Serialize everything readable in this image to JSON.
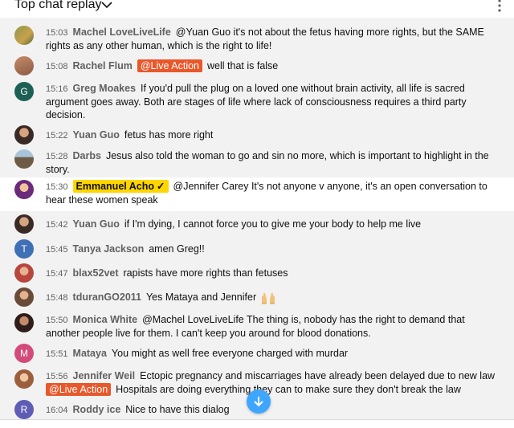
{
  "header": {
    "title": "Top chat replay",
    "chevron_icon": "chevron-down-icon",
    "menu_icon": "more-vert-icon"
  },
  "messages": [
    {
      "time": "15:03",
      "author": "Machel LoveLiveLife",
      "text": "@Yuan Guo it's not about the fetus having more rights, but the SAME rights as any other human, which is the right to life!"
    },
    {
      "time": "15:08",
      "author": "Rachel Flum",
      "mention": "@Live Action",
      "text": "well that is false"
    },
    {
      "time": "15:16",
      "author": "Greg Moakes",
      "avatar_letter": "G",
      "text": "If you'd pull the plug on a loved one without brain activity, all life is sacred argument goes away. Both are stages of life where lack of consciousness requires a third party decision."
    },
    {
      "time": "15:22",
      "author": "Yuan Guo",
      "text": "fetus has more right"
    },
    {
      "time": "15:28",
      "author": "Darbs",
      "text": "Jesus also told the woman to go and sin no more, which is important to highlight in the story."
    },
    {
      "time": "15:30",
      "author": "Emmanuel Acho",
      "owner_check": "✓",
      "text": "@Jennifer Carey It's not anyone v anyone, it's an open conversation to hear these women speak"
    },
    {
      "time": "15:42",
      "author": "Yuan Guo",
      "text": "if I'm dying, I cannot force you to give me your body to help me live"
    },
    {
      "time": "15:45",
      "author": "Tanya Jackson",
      "avatar_letter": "T",
      "text": "amen Greg!!"
    },
    {
      "time": "15:47",
      "author": "blax52vet",
      "text": "rapists have more rights than fetuses"
    },
    {
      "time": "15:48",
      "author": "tduranGO2011",
      "text": "Yes Mataya and Jennifer"
    },
    {
      "time": "15:50",
      "author": "Monica White",
      "text": "@Machel LoveLiveLife The thing is, nobody has the right to demand that another people live for them. I can't keep you around for blood donations."
    },
    {
      "time": "15:51",
      "author": "Mataya",
      "avatar_letter": "M",
      "text": "You might as well free everyone charged with murdar"
    },
    {
      "time": "15:56",
      "author": "Jennifer Weil",
      "text": "Ectopic pregnancy and miscarriages have already been delayed due to new law",
      "mention": "@Live Action",
      "text2": "Hospitals are doing everything they can to make sure they don't break the law"
    },
    {
      "time": "16:04",
      "author": "Roddy ice",
      "avatar_letter": "R",
      "text": "Nice to have this dialog"
    }
  ],
  "colors": {
    "mention_chip": "#e8582b",
    "owner_chip": "#ffd600",
    "greg_avatar": "#1d5f55",
    "tanya_avatar": "#3f6fb5",
    "mataya_avatar": "#d24b7a",
    "roddy_avatar": "#5e5cb5",
    "fab": "#3ea6ff"
  },
  "scroll_button_icon": "arrow-down-icon",
  "emoji_icon": "raising-hands-emoji-icon"
}
